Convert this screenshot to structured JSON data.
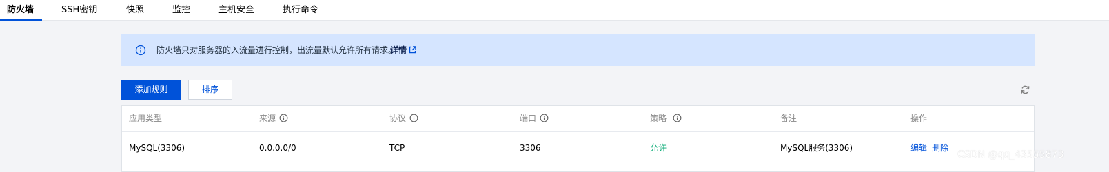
{
  "tabs": [
    {
      "label": "防火墙",
      "active": true
    },
    {
      "label": "SSH密钥",
      "active": false
    },
    {
      "label": "快照",
      "active": false
    },
    {
      "label": "监控",
      "active": false
    },
    {
      "label": "主机安全",
      "active": false
    },
    {
      "label": "执行命令",
      "active": false
    }
  ],
  "notice": {
    "icon": "info-circle-icon",
    "text": "防火墙只对服务器的入流量进行控制，出流量默认允许所有请求。",
    "link_label": "详情",
    "link_icon": "external-link-icon"
  },
  "toolbar": {
    "add_rule_label": "添加规则",
    "sort_label": "排序",
    "refresh_icon": "refresh-icon"
  },
  "table": {
    "headers": [
      {
        "label": "应用类型",
        "info": false
      },
      {
        "label": "来源",
        "info": true
      },
      {
        "label": "协议",
        "info": true
      },
      {
        "label": "端口",
        "info": true
      },
      {
        "label": "策略",
        "info": true
      },
      {
        "label": "备注",
        "info": false
      },
      {
        "label": "操作",
        "info": false
      }
    ],
    "rows": [
      {
        "app_type": "MySQL(3306)",
        "source": "0.0.0.0/0",
        "protocol": "TCP",
        "port": "3306",
        "policy": "允许",
        "note": "MySQL服务(3306)",
        "actions": [
          "编辑",
          "删除"
        ]
      }
    ]
  },
  "watermark": "CSDN @qq_43555873",
  "colors": {
    "accent": "#0052d9",
    "notice_bg": "#d5e5ff",
    "allow": "#00a870",
    "page_bg": "#f3f4f7"
  }
}
